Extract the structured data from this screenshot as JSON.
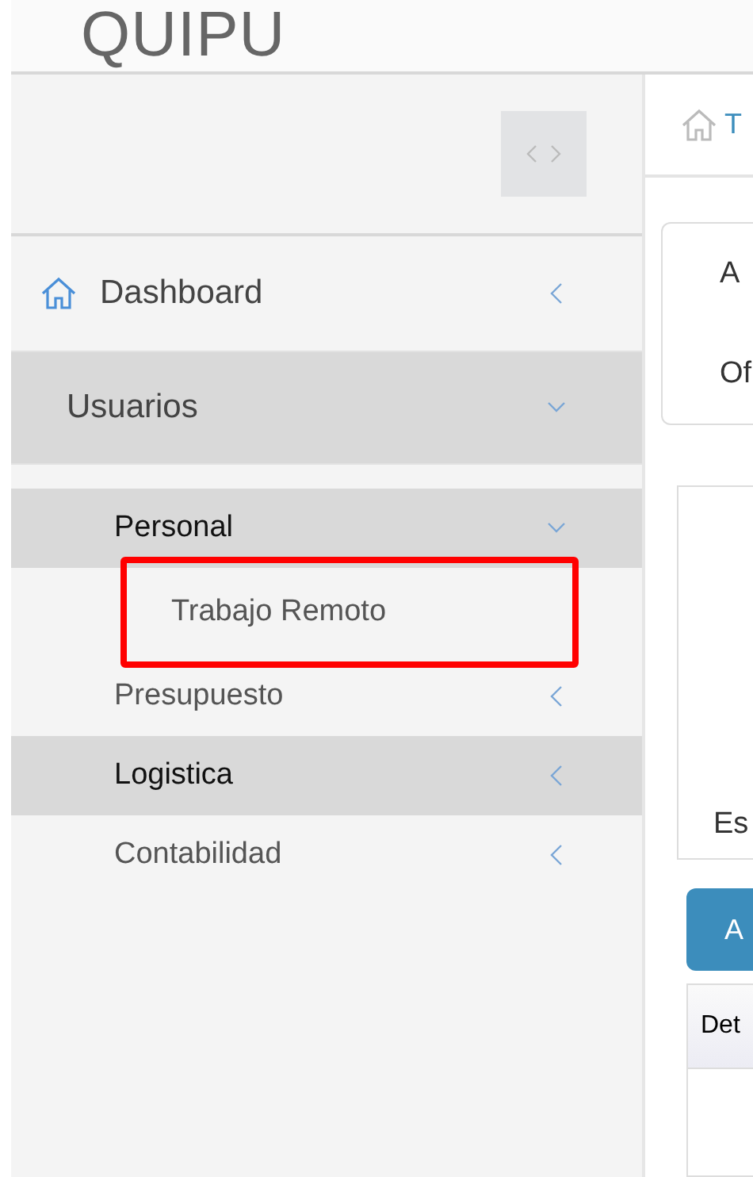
{
  "brand": "QUIPU",
  "sidebar": {
    "items": [
      {
        "label": "Dashboard",
        "expanded": false,
        "active": false
      },
      {
        "label": "Usuarios",
        "expanded": true,
        "active": true,
        "children": [
          {
            "label": "Personal",
            "expanded": true,
            "active": true,
            "children": [
              {
                "label": "Trabajo Remoto",
                "highlighted": true
              }
            ]
          },
          {
            "label": "Presupuesto",
            "expanded": false,
            "active": false
          },
          {
            "label": "Logistica",
            "expanded": false,
            "active": true
          },
          {
            "label": "Contabilidad",
            "expanded": false,
            "active": false
          }
        ]
      }
    ]
  },
  "breadcrumb": "T",
  "filter_card": {
    "rows": [
      "A",
      "Of"
    ]
  },
  "info_card": {
    "text": "Es"
  },
  "add_button": "A",
  "table": {
    "columns": [
      "Det"
    ]
  }
}
